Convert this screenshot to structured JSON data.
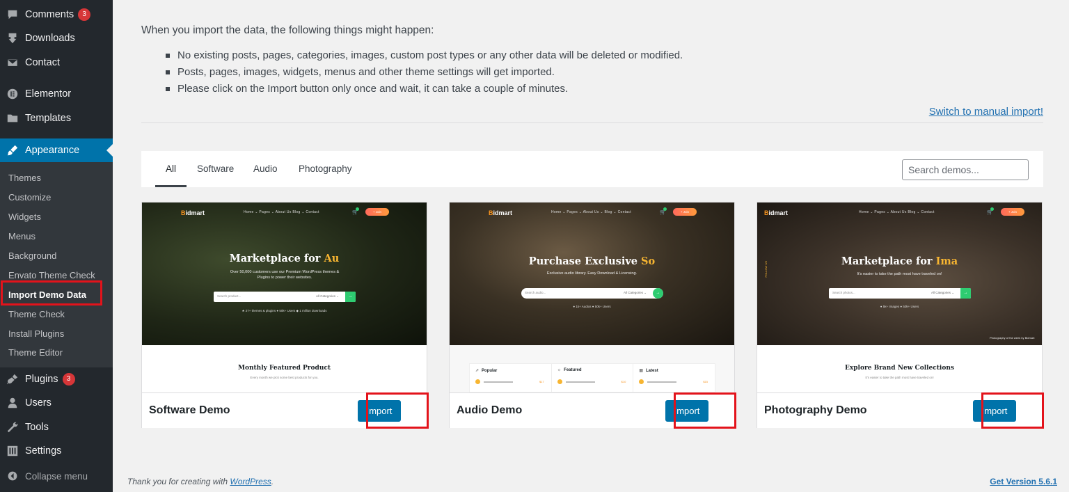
{
  "sidebar": {
    "items": [
      {
        "label": "Comments",
        "badge": "3",
        "icon": "comment-icon"
      },
      {
        "label": "Downloads",
        "icon": "download-icon"
      },
      {
        "label": "Contact",
        "icon": "mail-icon"
      },
      {
        "label": "Elementor",
        "icon": "elementor-icon"
      },
      {
        "label": "Templates",
        "icon": "folder-icon"
      },
      {
        "label": "Appearance",
        "icon": "paintbrush-icon"
      },
      {
        "label": "Plugins",
        "badge": "3",
        "icon": "plugin-icon"
      },
      {
        "label": "Users",
        "icon": "user-icon"
      },
      {
        "label": "Tools",
        "icon": "wrench-icon"
      },
      {
        "label": "Settings",
        "icon": "settings-icon"
      }
    ],
    "submenu": [
      "Themes",
      "Customize",
      "Widgets",
      "Menus",
      "Background",
      "Envato Theme Check",
      "Import Demo Data",
      "Theme Check",
      "Install Plugins",
      "Theme Editor"
    ],
    "collapse_label": "Collapse menu"
  },
  "intro": {
    "heading": "When you import the data, the following things might happen:",
    "bullets": [
      "No existing posts, pages, categories, images, custom post types or any other data will be deleted or modified.",
      "Posts, pages, images, widgets, menus and other theme settings will get imported.",
      "Please click on the Import button only once and wait, it can take a couple of minutes."
    ],
    "manual_link": "Switch to manual import!"
  },
  "filters": {
    "tabs": [
      "All",
      "Software",
      "Audio",
      "Photography"
    ],
    "active_tab": "All",
    "search_placeholder": "Search demos..."
  },
  "demos": [
    {
      "title": "Software Demo",
      "button": "Import",
      "preview": {
        "logo_initial": "B",
        "logo_rest": "idmart",
        "nav": "Home ⌄   Pages ⌄   About Us   Blog ⌄   Contact",
        "cta": "+ Join",
        "headline": "Marketplace for ",
        "headline_highlight": "Au",
        "subtext": "Over 50,000 customers use our Premium WordPress themes & Plugins to power their websites.",
        "search_placeholder": "Search product...",
        "search_category": "All Categories ⌄",
        "stats": "★ 27+ themes & plugins    ● 50k+ Users    ◆ 1 million downloads",
        "lower_title": "Monthly Featured Product",
        "lower_sub": "Every month we pick some best products for you."
      }
    },
    {
      "title": "Audio Demo",
      "button": "Import",
      "preview": {
        "logo_initial": "B",
        "logo_rest": "idmart",
        "nav": "Home ⌄   Pages ⌄   About Us ⌄   Blog ⌄   Contact",
        "cta": "+ Join",
        "headline": "Purchase Exclusive ",
        "headline_highlight": "So",
        "subtext": "Exclusive audio library. Easy Download & Licensing.",
        "search_placeholder": "Search audio...",
        "search_category": "All Categories ⌄",
        "stats": "● 1k+ Audios    ● 50k+ Users",
        "panels": [
          {
            "icon": "⇗",
            "title": "Popular",
            "price": "$17"
          },
          {
            "icon": "☼",
            "title": "Featured",
            "price": "$10"
          },
          {
            "icon": "▦",
            "title": "Latest",
            "price": "$15"
          }
        ]
      }
    },
    {
      "title": "Photography Demo",
      "button": "Import",
      "preview": {
        "logo_initial": "B",
        "logo_rest": "idmart",
        "nav": "Home ⌄   Pages ⌄   About Us   Blog ⌄   Contact",
        "cta": "+ Join",
        "headline": "Marketplace for ",
        "headline_highlight": "Ima",
        "subtext": "It's easier to take the path most have traveled on!",
        "search_placeholder": "Search photos...",
        "search_category": "All Categories ⌄",
        "stats": "● 5k+ Images    ● 50k+ Users",
        "caption": "Photography of the week by Bidmart",
        "vertical": "FOLLOW US",
        "lower_title": "Explore Brand New Collections",
        "lower_sub": "It's easier to take the path most have traveled on!"
      }
    }
  ],
  "footer": {
    "thanks_prefix": "Thank you for creating with ",
    "thanks_link": "WordPress",
    "thanks_suffix": ".",
    "version": "Get Version 5.6.1"
  },
  "colors": {
    "accent": "#0073aa",
    "sidebar_bg": "#23282d",
    "submenu_bg": "#32373c",
    "highlight": "#e3131b",
    "badge": "#d63638",
    "link": "#2271b1"
  }
}
